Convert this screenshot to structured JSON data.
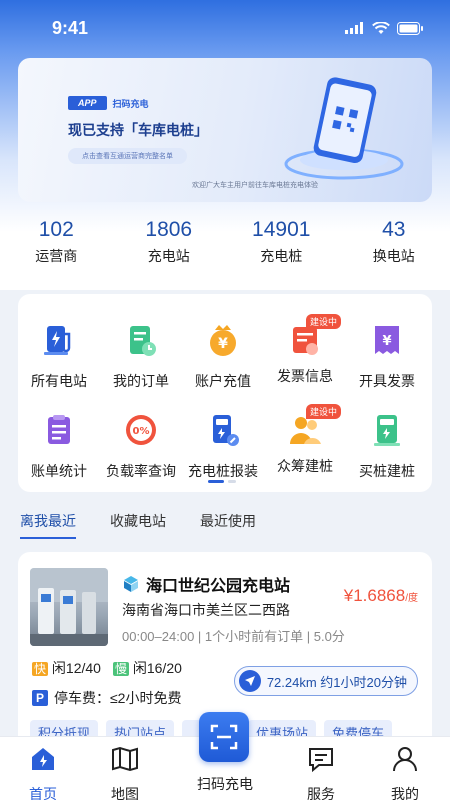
{
  "status_bar": {
    "time": "9:41"
  },
  "banner": {
    "app_tag": "APP",
    "scan_tag": "扫码充电",
    "headline": "现已支持「车库电桩」",
    "pill": "点击查看互通运营商完整名单",
    "footnote": "欢迎广大车主用户前往车库电桩充电体验"
  },
  "stats": [
    {
      "value": "102",
      "label": "运营商"
    },
    {
      "value": "1806",
      "label": "充电站"
    },
    {
      "value": "14901",
      "label": "充电桩"
    },
    {
      "value": "43",
      "label": "换电站"
    }
  ],
  "services": {
    "row1": [
      {
        "label": "所有电站",
        "icon": "station-icon"
      },
      {
        "label": "我的订单",
        "icon": "order-icon"
      },
      {
        "label": "账户充值",
        "icon": "recharge-icon"
      },
      {
        "label": "发票信息",
        "icon": "invoice-info-icon",
        "badge": "建设中"
      },
      {
        "label": "开具发票",
        "icon": "issue-invoice-icon"
      }
    ],
    "row2": [
      {
        "label": "账单统计",
        "icon": "bill-stats-icon"
      },
      {
        "label": "负载率查询",
        "icon": "load-rate-icon",
        "icon_text": "0%"
      },
      {
        "label": "充电桩报装",
        "icon": "pile-apply-icon"
      },
      {
        "label": "众筹建桩",
        "icon": "crowdfund-icon",
        "badge": "建设中"
      },
      {
        "label": "买桩建桩",
        "icon": "buy-pile-icon"
      }
    ]
  },
  "tabs": [
    "离我最近",
    "收藏电站",
    "最近使用"
  ],
  "station": {
    "name": "海口世纪公园充电站",
    "price": "¥1.6868",
    "price_unit": "/度",
    "address": "海南省海口市美兰区二西路",
    "hours": "00:00–24:00 | 1个小时前有订单 | 5.0分",
    "fast_tag": "快",
    "fast_avail": "闲12/40",
    "slow_tag": "慢",
    "slow_avail": "闲16/20",
    "distance": "72.24km 约1小时20分钟",
    "parking": "停车费：≤2小时免费",
    "chips": [
      "积分抵现",
      "热门站点",
      "",
      "优惠场站",
      "免费停车"
    ]
  },
  "nav": {
    "home": "首页",
    "map": "地图",
    "scan": "扫码充电",
    "service": "服务",
    "mine": "我的"
  },
  "colors": {
    "primary": "#2a5fd8",
    "price": "#f0533d",
    "badge": "#f0533d"
  }
}
